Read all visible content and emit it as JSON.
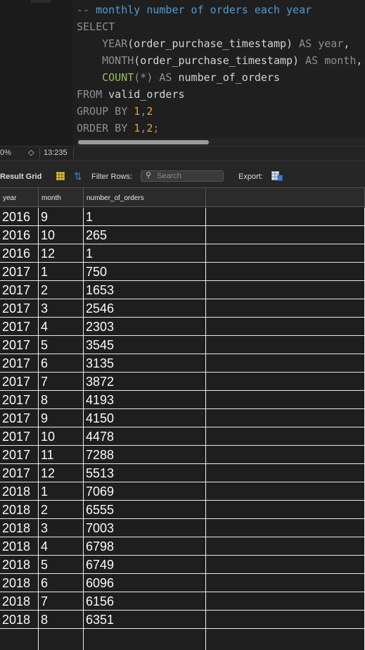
{
  "editor": {
    "lines": [
      {
        "tokens": [
          {
            "t": "-- monthly number of orders each year",
            "c": "tk-comment"
          }
        ]
      },
      {
        "tokens": [
          {
            "t": "SELECT",
            "c": "tk-kw"
          }
        ]
      },
      {
        "tokens": [
          {
            "t": "    ",
            "c": "tk-id"
          },
          {
            "t": "YEAR",
            "c": "tk-fn"
          },
          {
            "t": "(order_purchase_timestamp) ",
            "c": "tk-id"
          },
          {
            "t": "AS",
            "c": "tk-kw"
          },
          {
            "t": " ",
            "c": "tk-id"
          },
          {
            "t": "year",
            "c": "tk-fn"
          },
          {
            "t": ",",
            "c": "tk-id"
          }
        ]
      },
      {
        "tokens": [
          {
            "t": "    ",
            "c": "tk-id"
          },
          {
            "t": "MONTH",
            "c": "tk-fn"
          },
          {
            "t": "(order_purchase_timestamp) ",
            "c": "tk-id"
          },
          {
            "t": "AS",
            "c": "tk-kw"
          },
          {
            "t": " ",
            "c": "tk-id"
          },
          {
            "t": "month",
            "c": "tk-fn"
          },
          {
            "t": ",",
            "c": "tk-id"
          }
        ]
      },
      {
        "tokens": [
          {
            "t": "    ",
            "c": "tk-id"
          },
          {
            "t": "COUNT",
            "c": "tk-fn-green"
          },
          {
            "t": "(*) ",
            "c": "tk-fn"
          },
          {
            "t": "AS",
            "c": "tk-kw"
          },
          {
            "t": " number_of_orders",
            "c": "tk-id"
          }
        ]
      },
      {
        "tokens": [
          {
            "t": "FROM",
            "c": "tk-kw"
          },
          {
            "t": " valid_orders",
            "c": "tk-id"
          }
        ]
      },
      {
        "tokens": [
          {
            "t": "GROUP BY ",
            "c": "tk-kw"
          },
          {
            "t": "1",
            "c": "tk-num"
          },
          {
            "t": ",",
            "c": "tk-kw"
          },
          {
            "t": "2",
            "c": "tk-num"
          }
        ]
      },
      {
        "tokens": [
          {
            "t": "ORDER BY ",
            "c": "tk-kw"
          },
          {
            "t": "1",
            "c": "tk-num"
          },
          {
            "t": ",",
            "c": "tk-kw"
          },
          {
            "t": "2",
            "c": "tk-num"
          },
          {
            "t": ";",
            "c": "tk-kw"
          }
        ]
      }
    ]
  },
  "status": {
    "zoom": "0%",
    "zoom_stepper": "◇",
    "cursor_position": "13:235"
  },
  "toolbar": {
    "result_grid_label": "Result Grid",
    "filter_rows_label": "Filter Rows:",
    "search_placeholder": "Search",
    "export_label": "Export:"
  },
  "grid": {
    "columns": [
      "year",
      "month",
      "number_of_orders"
    ],
    "rows": [
      [
        "2016",
        "9",
        "1"
      ],
      [
        "2016",
        "10",
        "265"
      ],
      [
        "2016",
        "12",
        "1"
      ],
      [
        "2017",
        "1",
        "750"
      ],
      [
        "2017",
        "2",
        "1653"
      ],
      [
        "2017",
        "3",
        "2546"
      ],
      [
        "2017",
        "4",
        "2303"
      ],
      [
        "2017",
        "5",
        "3545"
      ],
      [
        "2017",
        "6",
        "3135"
      ],
      [
        "2017",
        "7",
        "3872"
      ],
      [
        "2017",
        "8",
        "4193"
      ],
      [
        "2017",
        "9",
        "4150"
      ],
      [
        "2017",
        "10",
        "4478"
      ],
      [
        "2017",
        "11",
        "7288"
      ],
      [
        "2017",
        "12",
        "5513"
      ],
      [
        "2018",
        "1",
        "7069"
      ],
      [
        "2018",
        "2",
        "6555"
      ],
      [
        "2018",
        "3",
        "7003"
      ],
      [
        "2018",
        "4",
        "6798"
      ],
      [
        "2018",
        "5",
        "6749"
      ],
      [
        "2018",
        "6",
        "6096"
      ],
      [
        "2018",
        "7",
        "6156"
      ],
      [
        "2018",
        "8",
        "6351"
      ]
    ]
  },
  "colors": {
    "comment": "#4e9bd9",
    "keyword": "#8f8f8f",
    "number": "#e3a23c",
    "accent_blue": "#2f7fd4"
  },
  "icons": [
    "grid-icon",
    "refresh-icon",
    "search-icon",
    "export-icon",
    "stepper-icon"
  ]
}
